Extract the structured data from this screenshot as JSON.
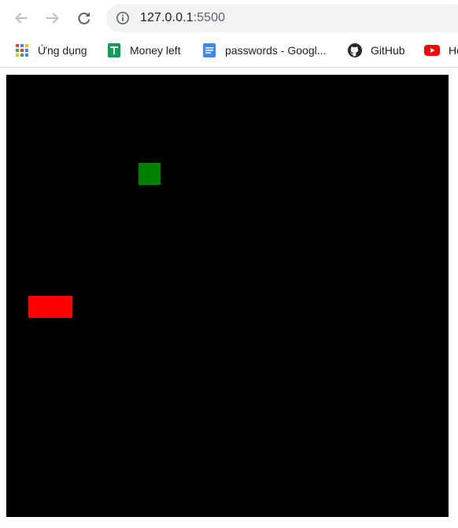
{
  "browser": {
    "nav": {
      "back_icon": "arrow-left-icon",
      "forward_icon": "arrow-right-icon",
      "reload_icon": "reload-icon"
    },
    "address": {
      "host": "127.0.0.1",
      "port": ":5500",
      "icon": "info-icon"
    },
    "bookmarks": [
      {
        "label": "Ứng dụng",
        "icon": "apps-grid-icon"
      },
      {
        "label": "Money left",
        "icon": "google-sheets-icon"
      },
      {
        "label": "passwords - Googl...",
        "icon": "google-docs-icon"
      },
      {
        "label": "GitHub",
        "icon": "github-icon"
      },
      {
        "label": "Ho",
        "icon": "youtube-icon"
      }
    ]
  },
  "game": {
    "background": "#000000",
    "food_color": "#008000",
    "snake_color": "#ff0000"
  }
}
